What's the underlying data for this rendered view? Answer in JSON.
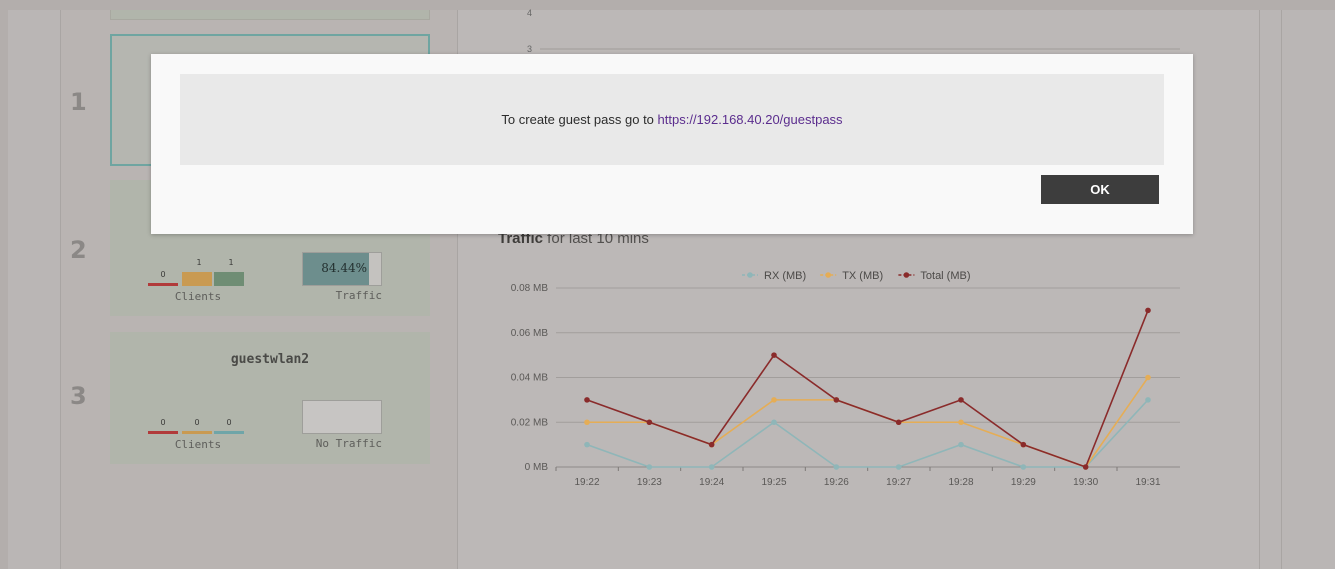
{
  "ranks": [
    "1",
    "2",
    "3"
  ],
  "cards": {
    "wlan2": {
      "clients": {
        "values": [
          "0",
          "1",
          "1"
        ],
        "label": "Clients"
      },
      "traffic": {
        "percent_text": "84.44%",
        "fraction": 0.84,
        "label": "Traffic"
      }
    },
    "wlan3": {
      "name": "guestwlan2",
      "clients": {
        "values": [
          "0",
          "0",
          "0"
        ],
        "label": "Clients"
      },
      "traffic": {
        "label": "No Traffic"
      }
    }
  },
  "traffic_section": {
    "title_bold": "Traffic",
    "title_rest": " for last 10 mins"
  },
  "chart_data": {
    "type": "line",
    "x": [
      "19:22",
      "19:23",
      "19:24",
      "19:25",
      "19:26",
      "19:27",
      "19:28",
      "19:29",
      "19:30",
      "19:31"
    ],
    "series": [
      {
        "name": "RX (MB)",
        "color": "#8fb6b8",
        "values": [
          0.01,
          0,
          0,
          0.02,
          0,
          0,
          0.01,
          0,
          0,
          0.03
        ]
      },
      {
        "name": "TX (MB)",
        "color": "#e5ad56",
        "values": [
          0.02,
          0.02,
          0.01,
          0.03,
          0.03,
          0.02,
          0.02,
          0.01,
          0,
          0.04
        ]
      },
      {
        "name": "Total (MB)",
        "color": "#8a2b2b",
        "values": [
          0.03,
          0.02,
          0.01,
          0.05,
          0.03,
          0.02,
          0.03,
          0.01,
          0,
          0.07
        ]
      }
    ],
    "y_ticks": [
      "0 MB",
      "0.02 MB",
      "0.04 MB",
      "0.06 MB",
      "0.08 MB"
    ],
    "ylim": [
      0,
      0.08
    ],
    "legend_position": "top",
    "upper_chart_ticks": [
      "4",
      "3"
    ]
  },
  "dialog": {
    "message_prefix": "To create guest pass go to ",
    "link": "https://192.168.40.20/guestpass",
    "ok_label": "OK"
  },
  "colors": {
    "overlay_tint": "#b3aeac",
    "dialog_bg": "#f9f9f9",
    "ok_button": "#3d3d3d",
    "link": "#5b2d8e"
  }
}
